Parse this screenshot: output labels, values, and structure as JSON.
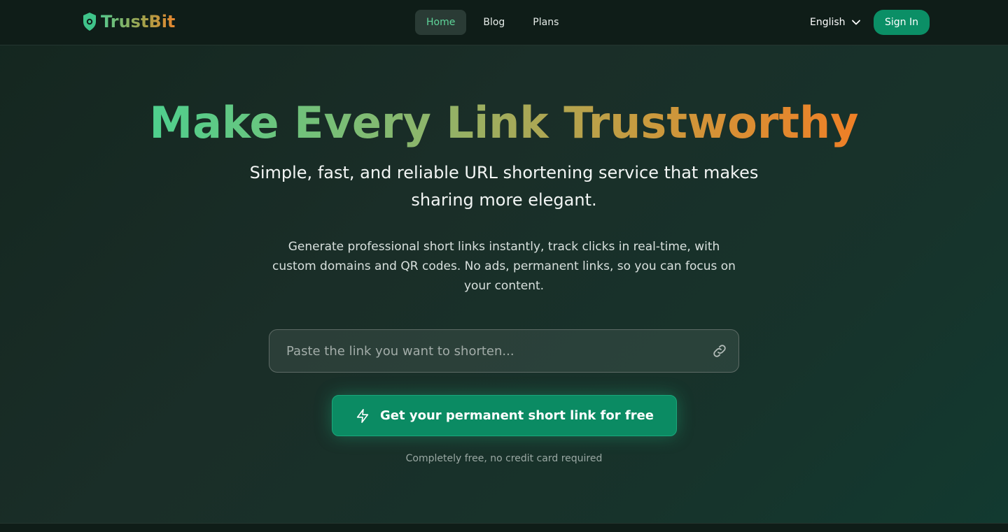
{
  "header": {
    "logo_text": "TrustBit",
    "nav": [
      {
        "label": "Home",
        "active": true
      },
      {
        "label": "Blog",
        "active": false
      },
      {
        "label": "Plans",
        "active": false
      }
    ],
    "language": "English",
    "sign_in": "Sign In"
  },
  "hero": {
    "title": "Make Every Link Trustworthy",
    "subtitle": "Simple, fast, and reliable URL shortening service that makes sharing more elegant.",
    "description": "Generate professional short links instantly, track clicks in real-time, with custom domains and QR codes. No ads, permanent links, so you can focus on your content.",
    "input_placeholder": "Paste the link you want to shorten...",
    "cta_label": "Get your permanent short link for free",
    "note": "Completely free, no credit card required"
  },
  "colors": {
    "accent": "#0b8f66",
    "title_gradient_start": "#4ed08e",
    "title_gradient_end": "#ef7f26"
  },
  "icons": {
    "logo": "shield-icon",
    "language": "chevron-down-icon",
    "input": "link-icon",
    "cta": "lightning-icon"
  }
}
